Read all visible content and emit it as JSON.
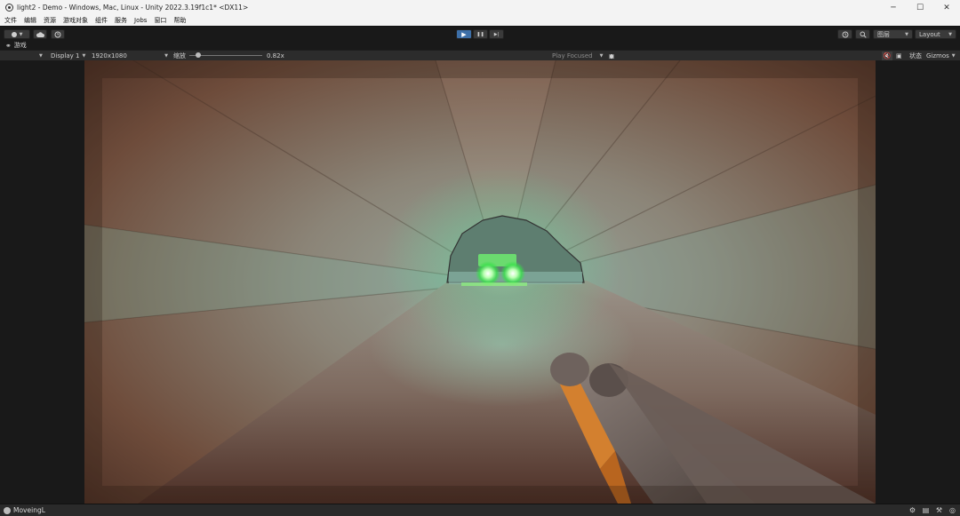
{
  "window": {
    "title": "light2 - Demo - Windows, Mac, Linux - Unity 2022.3.19f1c1* <DX11>",
    "controls": {
      "minimize": "─",
      "maximize": "☐",
      "close": "✕"
    }
  },
  "menu": {
    "items": [
      "文件",
      "编辑",
      "资源",
      "游戏对象",
      "组件",
      "服务",
      "Jobs",
      "窗口",
      "帮助"
    ]
  },
  "toolbar": {
    "account_icon": "account-icon",
    "cloud_icon": "cloud-icon",
    "collab_icon": "collab-icon",
    "play_icon": "▶",
    "pause_icon": "❚❚",
    "step_icon": "▶|",
    "history_icon": "history-icon",
    "search_icon": "search-icon",
    "layers_label": "图层",
    "layout_label": "Layout"
  },
  "game_tab": {
    "label": "游戏"
  },
  "game_bar": {
    "display": "Display 1",
    "resolution": "1920x1080",
    "scale_label": "缩放",
    "scale_value": "0.82x",
    "scale_fraction": 0.09,
    "play_mode": "Play Focused",
    "stats_label": "状态",
    "gizmos_label": "Gizmos"
  },
  "statusbar": {
    "message": "MoveingL"
  },
  "colors": {
    "play_active": "#3d6fa8",
    "glow": "#4dff7a",
    "tunnel_warm": "#8a5a42",
    "tunnel_cool": "#6fa79a"
  }
}
